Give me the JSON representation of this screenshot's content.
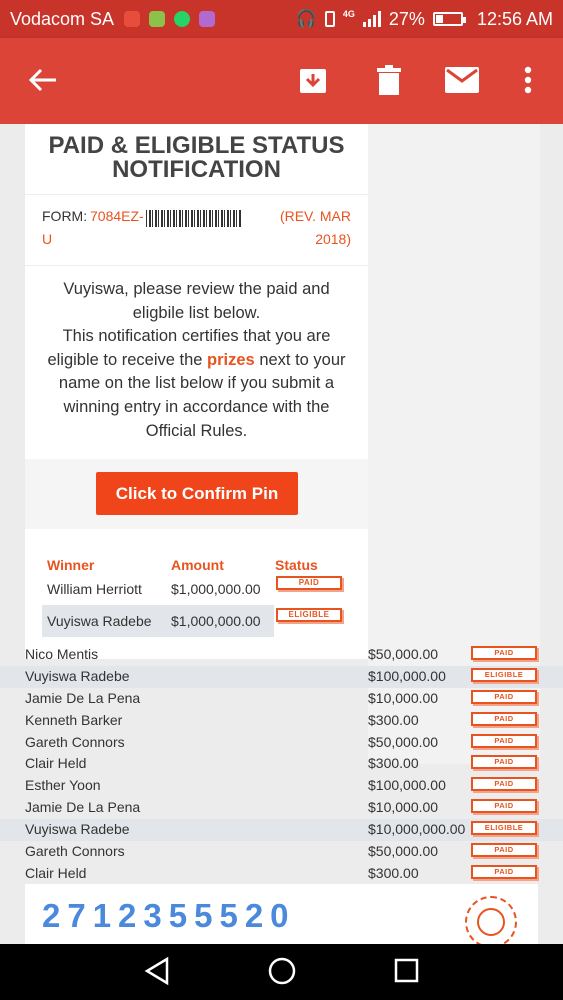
{
  "status_bar": {
    "carrier": "Vodacom SA",
    "network": "4G",
    "battery": "27%",
    "battery_level": 0.27,
    "time": "12:56 AM",
    "app_icon_colors": [
      "#e84d3c",
      "#8bc34a",
      "#25d366",
      "#b36ad0"
    ]
  },
  "app_bar": {
    "icons": [
      "back-arrow-icon",
      "archive-icon",
      "delete-icon",
      "mail-icon",
      "more-icon"
    ]
  },
  "email": {
    "title_line1": "PAID & ELIGIBLE STATUS",
    "title_line2": "NOTIFICATION",
    "form_label": "FORM:",
    "form_code": "7084EZ-",
    "form_code_2": "U",
    "rev_line1": "(REV. MAR",
    "rev_line2": "2018)",
    "message_line1": "Vuyiswa, please review the paid and",
    "message_line2": "eligbile list below.",
    "message_line3": "This notification certifies that you are",
    "message_line4_pre": "eligible to receive the ",
    "message_line4_emph": "prizes",
    "message_line4_post": " next to your",
    "message_line5": "name on the list below if you submit a",
    "message_line6": "winning entry in accordance with the",
    "message_line7": "Official Rules.",
    "cta_label": "Click to Confirm Pin",
    "winners_headers": [
      "Winner",
      "Amount",
      "Status"
    ],
    "winners": [
      {
        "name": "William Herriott",
        "amount": "$1,000,000.00",
        "status": "PAID"
      },
      {
        "name": "Vuyiswa Radebe",
        "amount": "$1,000,000.00",
        "status": "ELIGIBLE"
      }
    ],
    "list": [
      {
        "name": "Nico Mentis",
        "amount": "$50,000.00",
        "status": "PAID"
      },
      {
        "name": "Vuyiswa Radebe",
        "amount": "$100,000.00",
        "status": "ELIGIBLE"
      },
      {
        "name": "Jamie De La Pena",
        "amount": "$10,000.00",
        "status": "PAID"
      },
      {
        "name": "Kenneth Barker",
        "amount": "$300.00",
        "status": "PAID"
      },
      {
        "name": "Gareth Connors",
        "amount": "$50,000.00",
        "status": "PAID"
      },
      {
        "name": "Clair Held",
        "amount": "$300.00",
        "status": "PAID"
      },
      {
        "name": "Esther Yoon",
        "amount": "$100,000.00",
        "status": "PAID"
      },
      {
        "name": "Jamie De La Pena",
        "amount": "$10,000.00",
        "status": "PAID"
      },
      {
        "name": "Vuyiswa Radebe",
        "amount": "$10,000,000.00",
        "status": "ELIGIBLE"
      },
      {
        "name": "Gareth Connors",
        "amount": "$50,000.00",
        "status": "PAID"
      },
      {
        "name": "Clair Held",
        "amount": "$300.00",
        "status": "PAID"
      }
    ],
    "pin": "2712355520"
  },
  "nav_bar": {
    "icons": [
      "back-triangle-icon",
      "home-circle-icon",
      "recents-square-icon"
    ]
  },
  "colors": {
    "status_bar": "#c8332a",
    "app_bar": "#db4437",
    "accent": "#e8541f",
    "cta": "#f0451b",
    "pin": "#4a89dc",
    "highlight_row": "#e2e5ea"
  }
}
